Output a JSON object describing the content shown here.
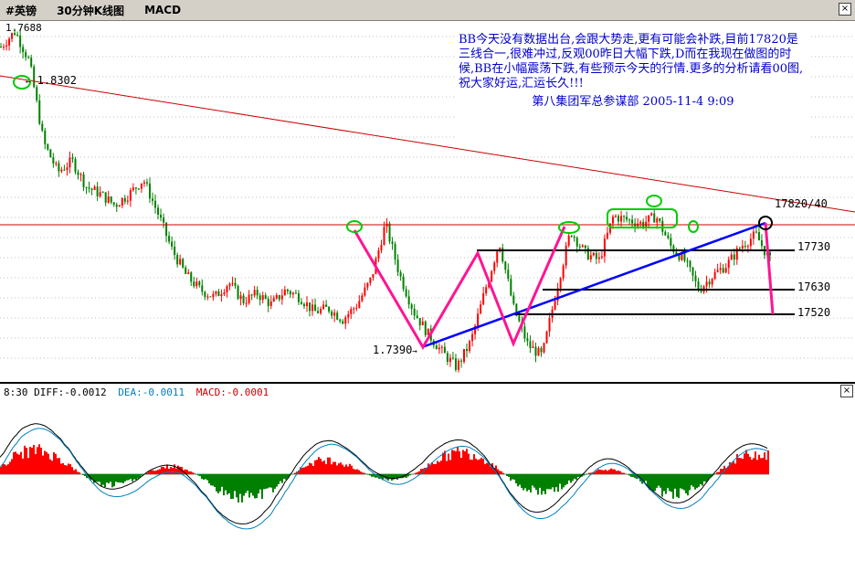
{
  "toolbar": {
    "symbol": "#英镑",
    "period": "30分钟K线图",
    "indicator": "MACD"
  },
  "axis": {
    "top_value": "1.7688"
  },
  "annotation": {
    "text": "BB今天没有数据出台,会跟大势走,更有可能会补跌,目前17820是三线合一,很难冲过,反观00昨日大幅下跌,D而在我现在做图的时候,BB在小幅震荡下跌,有些预示今天的行情.更多的分析请看00图,祝大家好运,汇运长久!!!",
    "signature": "第八集团军总参谋部  2005-11-4  9:09"
  },
  "price_labels": {
    "high": "1.8302",
    "low": "1.7390",
    "resistance": "17820/40",
    "level1": "17730",
    "level2": "17630",
    "level3": "17520"
  },
  "macd": {
    "time": "8:30",
    "diff": "DIFF:-0.0012",
    "dea": "DEA:-0.0011",
    "macd": "MACD:-0.0001"
  },
  "colors": {
    "up_candle": "#ff0000",
    "down_candle": "#008000",
    "pattern_line": "#ff1493",
    "trend_line": "#0000ff",
    "resistance_line": "#cc0000",
    "marker": "#00cc00"
  },
  "chart_data": {
    "type": "candlestick",
    "y_range_visible": [
      1.7375,
      1.833
    ],
    "key_prices": [
      1.8302,
      1.739,
      1.782,
      1.773,
      1.763,
      1.752
    ],
    "close_path_approx": [
      1.826,
      1.8302,
      1.822,
      1.8,
      1.792,
      1.795,
      1.788,
      1.786,
      1.783,
      1.786,
      1.79,
      1.781,
      1.771,
      1.764,
      1.76,
      1.758,
      1.762,
      1.757,
      1.759,
      1.756,
      1.76,
      1.758,
      1.754,
      1.755,
      1.752,
      1.756,
      1.763,
      1.778,
      1.764,
      1.754,
      1.748,
      1.743,
      1.739,
      1.746,
      1.76,
      1.773,
      1.755,
      1.745,
      1.742,
      1.76,
      1.776,
      1.77,
      1.768,
      1.78,
      1.779,
      1.778,
      1.78,
      1.772,
      1.768,
      1.76,
      1.764,
      1.767,
      1.772,
      1.775,
      1.768
    ]
  }
}
